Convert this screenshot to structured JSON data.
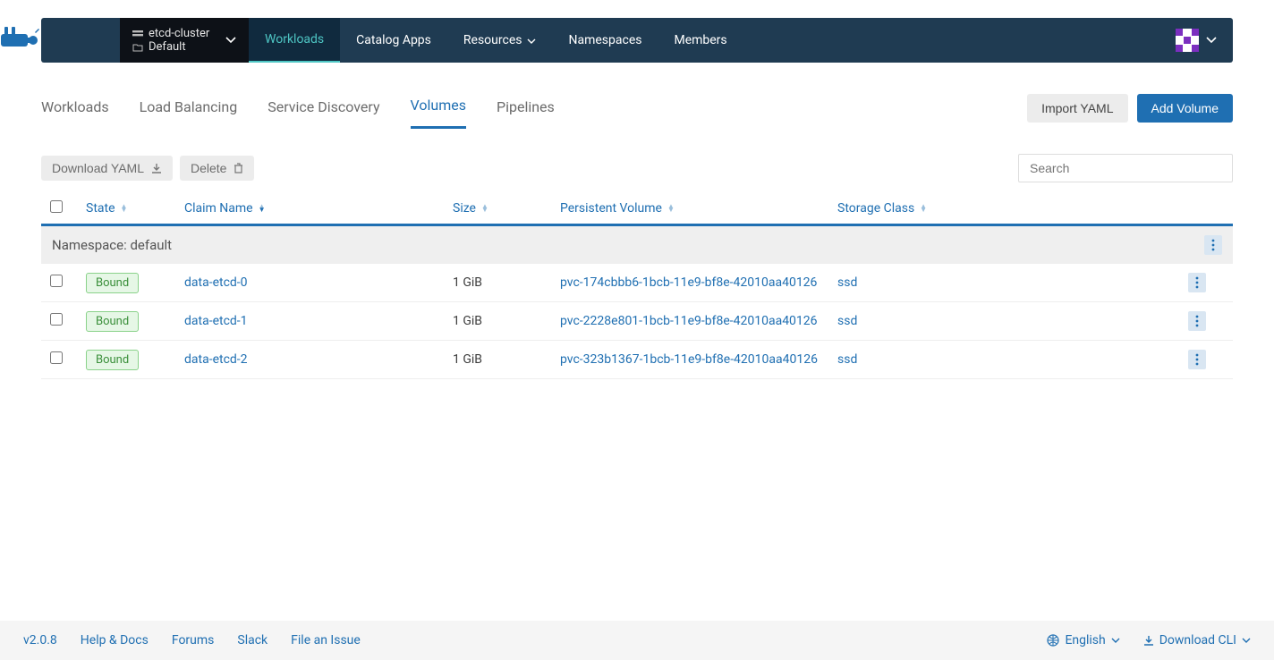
{
  "header": {
    "cluster_name": "etcd-cluster",
    "project_name": "Default",
    "nav": [
      {
        "label": "Workloads",
        "active": true
      },
      {
        "label": "Catalog Apps"
      },
      {
        "label": "Resources",
        "dropdown": true
      },
      {
        "label": "Namespaces"
      },
      {
        "label": "Members"
      }
    ]
  },
  "subtabs": {
    "items": [
      {
        "label": "Workloads"
      },
      {
        "label": "Load Balancing"
      },
      {
        "label": "Service Discovery"
      },
      {
        "label": "Volumes",
        "active": true
      },
      {
        "label": "Pipelines"
      }
    ],
    "import_yaml": "Import YAML",
    "add_volume": "Add Volume"
  },
  "toolbar": {
    "download_yaml": "Download YAML",
    "delete": "Delete",
    "search_placeholder": "Search"
  },
  "table": {
    "columns": {
      "state": "State",
      "claim_name": "Claim Name",
      "size": "Size",
      "persistent_volume": "Persistent Volume",
      "storage_class": "Storage Class"
    },
    "namespace_label": "Namespace: default",
    "rows": [
      {
        "state": "Bound",
        "claim": "data-etcd-0",
        "size": "1 GiB",
        "pv": "pvc-174cbbb6-1bcb-11e9-bf8e-42010aa40126",
        "sc": "ssd"
      },
      {
        "state": "Bound",
        "claim": "data-etcd-1",
        "size": "1 GiB",
        "pv": "pvc-2228e801-1bcb-11e9-bf8e-42010aa40126",
        "sc": "ssd"
      },
      {
        "state": "Bound",
        "claim": "data-etcd-2",
        "size": "1 GiB",
        "pv": "pvc-323b1367-1bcb-11e9-bf8e-42010aa40126",
        "sc": "ssd"
      }
    ]
  },
  "footer": {
    "version": "v2.0.8",
    "links": [
      "Help & Docs",
      "Forums",
      "Slack",
      "File an Issue"
    ],
    "language": "English",
    "download_cli": "Download CLI"
  }
}
